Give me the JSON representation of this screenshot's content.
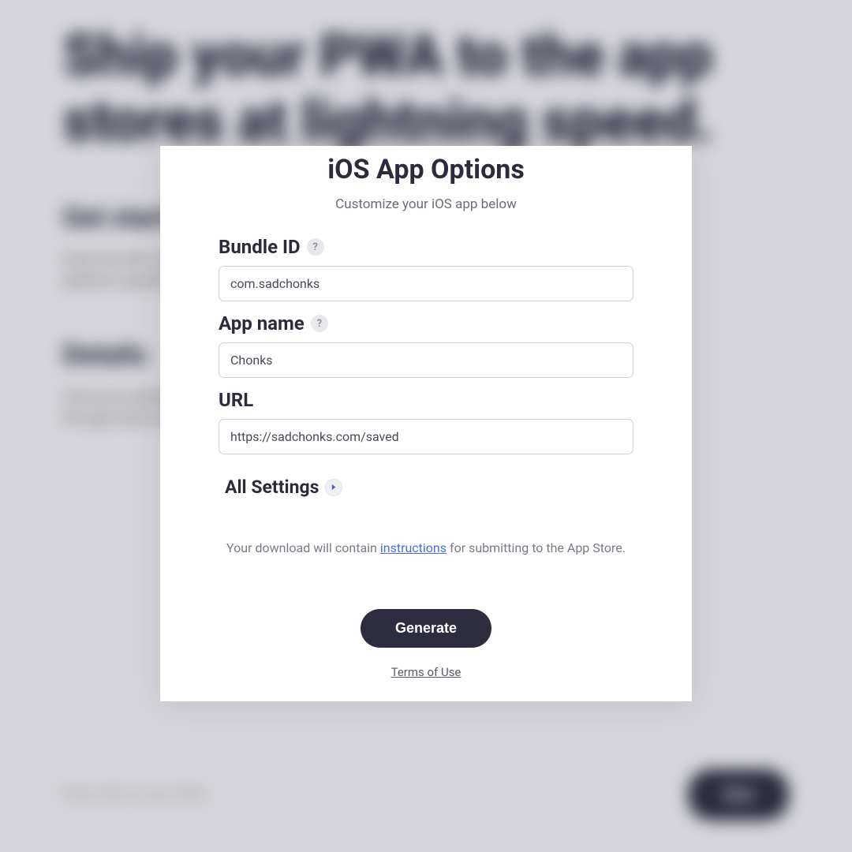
{
  "backdrop": {
    "heading": "Ship your PWA to the app stores at lightning speed.",
    "section1_title": "Get started",
    "section1_text": "Enter the URL to your PWA below, hit start, and we'll generate platform-specific packages for you.",
    "section2_title": "Details",
    "section2_text": "Once your package is ready, you can download and submit to the app stores straight away.",
    "input_placeholder": "Enter URL to your PWA",
    "button": "Start"
  },
  "modal": {
    "title": "iOS App Options",
    "subtitle": "Customize your iOS app below",
    "bundle_id_label": "Bundle ID",
    "bundle_id_value": "com.sadchonks",
    "app_name_label": "App name",
    "app_name_value": "Chonks",
    "url_label": "URL",
    "url_value": "https://sadchonks.com/saved",
    "all_settings_label": "All Settings",
    "info_text_before": "Your download will contain ",
    "info_link": "instructions",
    "info_text_after": " for submitting to the App Store.",
    "generate_button": "Generate",
    "terms_link": "Terms of Use"
  }
}
